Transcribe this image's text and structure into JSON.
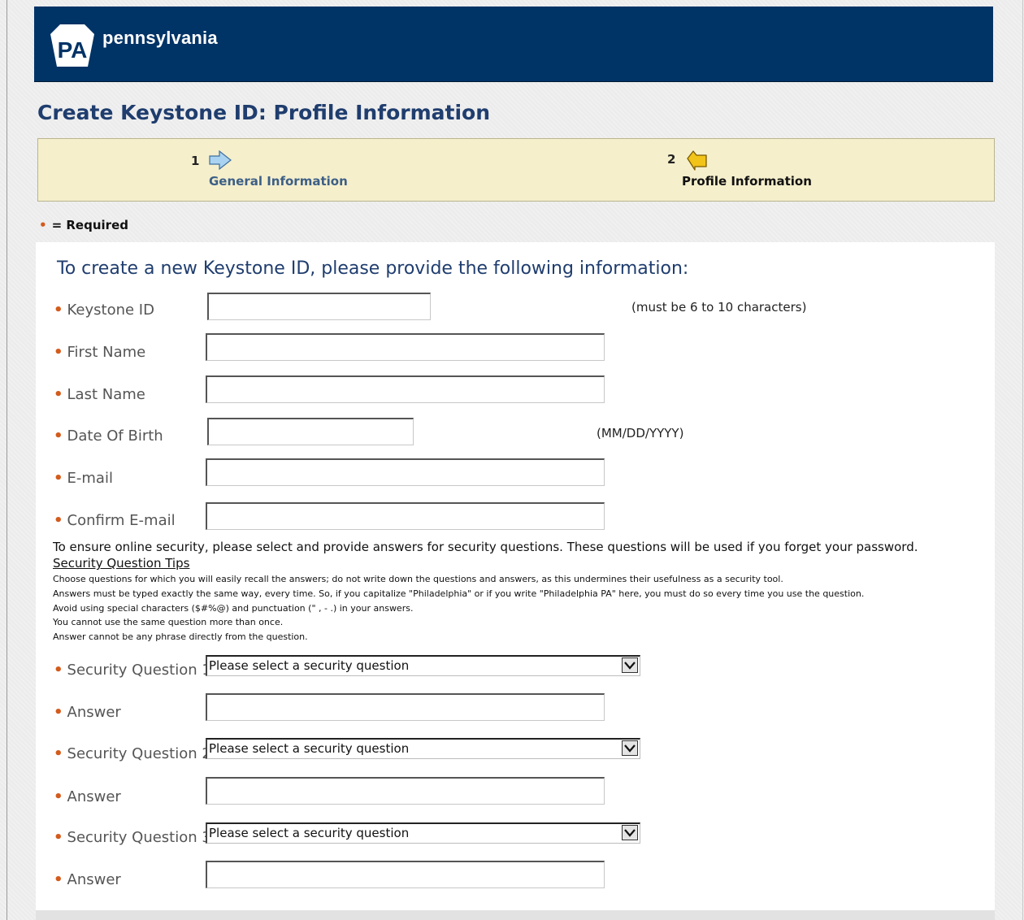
{
  "header": {
    "logo_text": "PA",
    "brand": "pennsylvania"
  },
  "page_title": "Create Keystone ID: Profile Information",
  "steps": [
    {
      "number": "1",
      "label": "General Information"
    },
    {
      "number": "2",
      "label": "Profile Information"
    }
  ],
  "required_legend": {
    "marker": "•",
    "text": "= Required"
  },
  "form": {
    "intro": "To create a new Keystone ID, please provide the following information:",
    "fields": {
      "keystone_id": {
        "label": "Keystone ID",
        "value": "",
        "hint": "(must be 6 to 10 characters)"
      },
      "first_name": {
        "label": "First Name",
        "value": ""
      },
      "last_name": {
        "label": "Last Name",
        "value": ""
      },
      "date_of_birth": {
        "label": "Date Of Birth",
        "value": "",
        "hint": "(MM/DD/YYYY)"
      },
      "email": {
        "label": "E-mail",
        "value": ""
      },
      "confirm_email": {
        "label": "Confirm E-mail",
        "value": ""
      }
    },
    "security": {
      "intro": "To ensure online security, please select and provide answers for security questions. These questions will be used if you forget your password.",
      "tips_link": "Security Question Tips",
      "tips": [
        "Choose questions for which you will easily recall the answers; do not write down the questions and answers, as this undermines their usefulness as a security tool.",
        "Answers must be typed exactly the same way, every time. So, if you capitalize \"Philadelphia\" or if you write \"Philadelphia PA\" here, you must do so every time you use the question.",
        "Avoid using special characters ($#%@) and punctuation (\" , - .) in your answers.",
        "You cannot use the same question more than once.",
        "Answer cannot be any phrase directly from the question."
      ],
      "questions": [
        {
          "label": "Security Question 1",
          "selected": "Please select a security question",
          "answer_label": "Answer",
          "answer_value": ""
        },
        {
          "label": "Security Question 2",
          "selected": "Please select a security question",
          "answer_label": "Answer",
          "answer_value": ""
        },
        {
          "label": "Security Question 3",
          "selected": "Please select a security question",
          "answer_label": "Answer",
          "answer_value": ""
        }
      ]
    }
  },
  "colors": {
    "header_bg": "#003366",
    "title": "#1f3d6e",
    "step_bar_bg": "#f5efcc",
    "required_marker": "#d35b1c",
    "step1_icon": "#a9d3f0",
    "step2_icon": "#f2c318"
  },
  "icons": [
    "keystone-logo-icon",
    "arrow-right-icon",
    "pointing-arrow-icon",
    "chevron-down-icon"
  ]
}
